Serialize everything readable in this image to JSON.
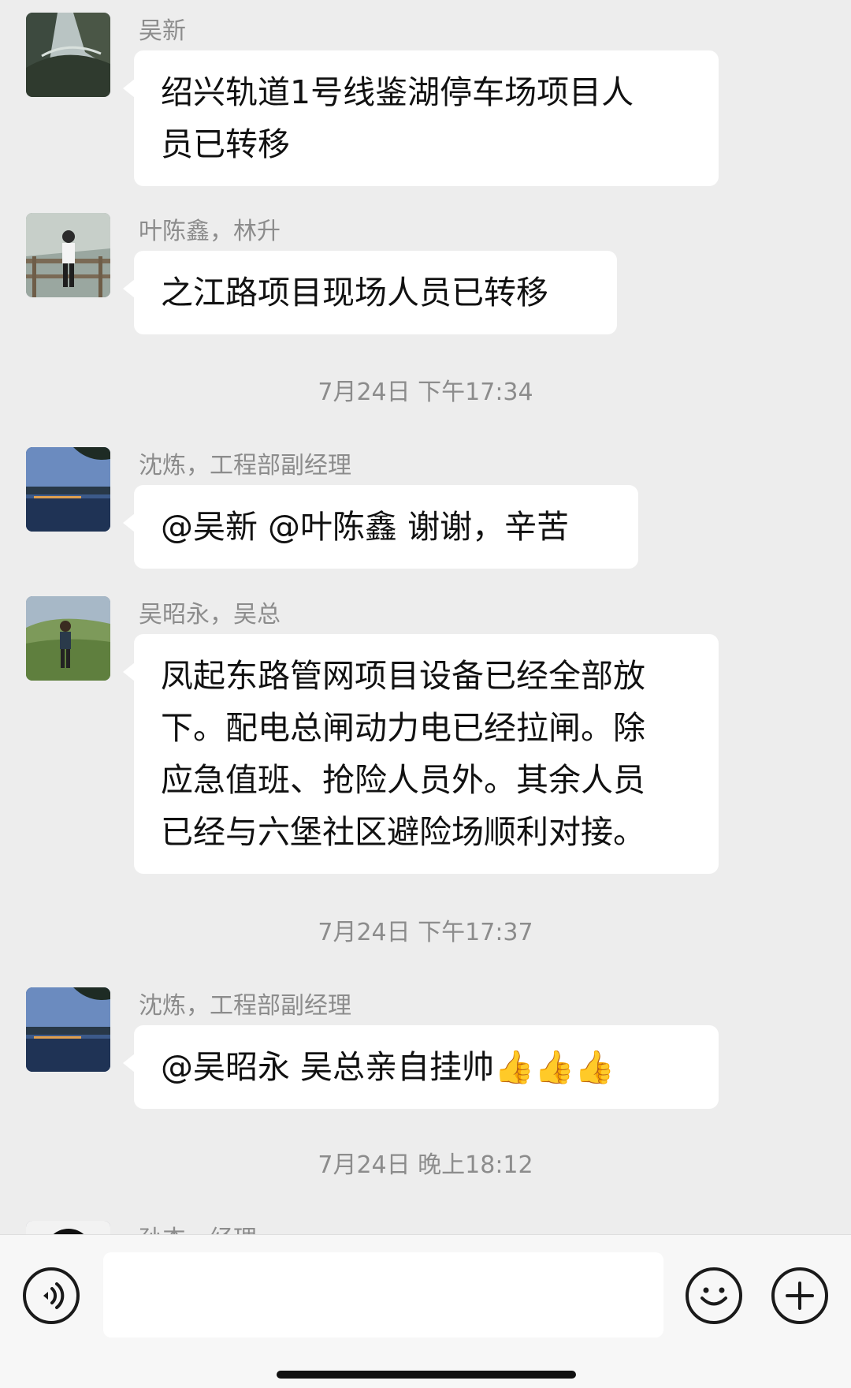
{
  "messages": [
    {
      "sender": "吴新",
      "lines": [
        "绍兴轨道1号线鉴湖停车场项目人",
        "员已转移"
      ]
    },
    {
      "sender": "叶陈鑫，林升",
      "lines": [
        "之江路项目现场人员已转移"
      ]
    },
    {
      "sender": "沈炼，工程部副经理",
      "lines": [
        "@吴新  @叶陈鑫   谢谢，辛苦"
      ]
    },
    {
      "sender": "吴昭永，吴总",
      "lines": [
        "凤起东路管网项目设备已经全部放",
        "下。配电总闸动力电已经拉闸。除",
        "应急值班、抢险人员外。其余人员",
        "已经与六堡社区避险场顺利对接。"
      ]
    },
    {
      "sender": "沈炼，工程部副经理",
      "text": "@吴昭永   吴总亲自挂帅",
      "emoji": "👍👍👍"
    },
    {
      "sender": "孙杰，经理"
    }
  ],
  "timestamps": [
    "7月24日 下午17:34",
    "7月24日 下午17:37",
    "7月24日 晚上18:12"
  ],
  "input_bar": {
    "voice_icon": "voice-icon",
    "emoji_icon": "emoji-icon",
    "more_icon": "plus-icon"
  }
}
